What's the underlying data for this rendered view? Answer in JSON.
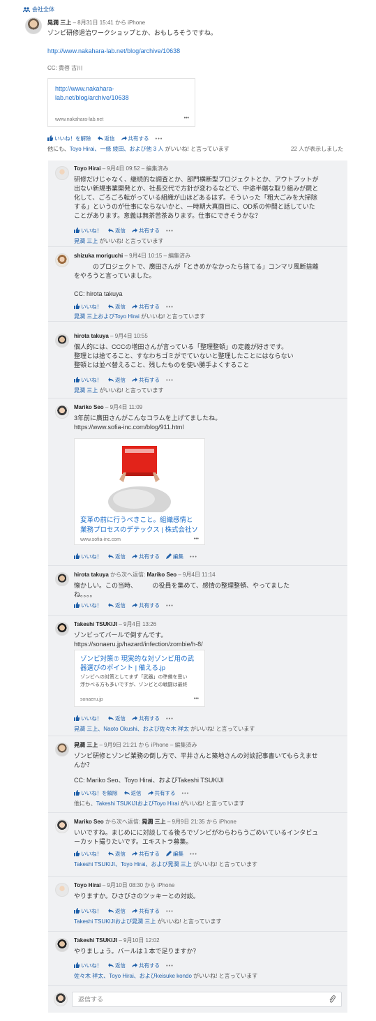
{
  "group": {
    "icon": "group-icon",
    "label": "会社全体"
  },
  "main": {
    "author": "晃潤 三上",
    "meta": " – 8月31日 15:41 から iPhone",
    "text": "ゾンビ研修退治ワークショップとか、おもしろそうですね。",
    "url": "http://www.nakahara-lab.net/blog/archive/10638",
    "cc": "CC: 貴啓 古川",
    "card": {
      "title_line1": "http://www.nakahara-",
      "title_line2": "lab.net/blog/archive/10638",
      "domain": "www.nakahara-lab.net",
      "more": "•••"
    },
    "actions": {
      "unlike": "いいね！を解除",
      "reply": "返信",
      "share": "共有する",
      "more": "•••"
    },
    "likes": {
      "prefix": "他にも、",
      "users": "Toyo Hirai、一條 綾田、および他 3 人",
      "suffix": " がいいね! と言っています"
    },
    "views": "22 人が表示しました"
  },
  "replies": [
    {
      "author": "Toyo Hirai",
      "meta": " – 9月4日 09:52 – 編集済み",
      "lines": [
        "研修だけじゃなく、継続的な調査とか、部門横断型プロジェクトとか、アウトプットが",
        "出ない新規事業開発とか、社長交代で方針が変わるなどで、中途半端な取り組みが屍と",
        "化して、ごろごろ転がっている組織が山ほどあるはず。そういった「粗大ごみを大掃除",
        "する」というのが仕事にならないかと、一時期大真面目に、OD系の仲間と話していた",
        "ことがあります。意義は無茶苦茶あります。仕事にできそうかな？"
      ],
      "actions": {
        "like": "いいね！",
        "reply": "返信",
        "share": "共有する",
        "more": "•••"
      },
      "likes": {
        "users": "晃潤 三上",
        "suffix": " がいいね! と言っています"
      }
    },
    {
      "author": "shizuka moriguchi",
      "meta": " – 9月4日 10:15 – 編集済み",
      "lines": [
        "　　　のプロジェクトで、廣田さんが「ときめかなかったら捨てる」コンマリ風断捨離",
        "をやろうと言っていました。"
      ],
      "cc": "CC: hirota takuya",
      "actions": {
        "like": "いいね！",
        "reply": "返信",
        "share": "共有する",
        "more": "•••"
      },
      "likes": {
        "users": "晃潤 三上およびToyo Hirai",
        "suffix": " がいいね! と言っています"
      }
    },
    {
      "author": "hirota takuya",
      "meta": " – 9月4日 10:55",
      "lines": [
        "個人的には、CCCの増田さんが言っている「整理整頓」の定義が好きです。",
        "整理とは捨てること、すなわちゴミがでていないと整理したことにはならない",
        "整頓とは並べ替えること、残したものを使い勝手よくすること"
      ],
      "actions": {
        "like": "いいね！",
        "reply": "返信",
        "share": "共有する",
        "more": "•••"
      },
      "likes": {
        "users": "晃潤 三上",
        "suffix": " がいいね! と言っています"
      }
    },
    {
      "author": "Mariko Seo",
      "meta": " – 9月4日 11:09",
      "lines": [
        "3年前に廣田さんがこんなコラムを上げてましたね。"
      ],
      "url": "https://www.sofia-inc.com/blog/911.html",
      "card": {
        "title_line1": "変革の前に行うべきこと。組織感情と",
        "title_line2": "業務プロセスのデテックス | 株式会社ソ",
        "domain": "www.sofia-inc.com",
        "more": "•••"
      },
      "actions": {
        "like": "いいね！",
        "reply": "返信",
        "share": "共有する",
        "edit": "編集",
        "more": "•••"
      }
    },
    {
      "author": "hirota takuya",
      "meta_mid": " から次へ返信: ",
      "reply_to": "Mariko Seo",
      "meta": " – 9月4日 11:14",
      "lines": [
        "懐かしい。この当時、　　　の役員を集めて、感情の整理整頓、やってました",
        "ね。。。。"
      ],
      "actions": {
        "like": "いいね！",
        "reply": "返信",
        "share": "共有する",
        "more": "•••"
      }
    },
    {
      "author": "Takeshi TSUKIJI",
      "meta": " – 9月4日 13:26",
      "lines": [
        "ゾンビってバールで倒すんです。"
      ],
      "url": " https://sonaeru.jp/hazard/infection/zombie/h-8/",
      "card": {
        "title_line1": "ゾンビ対策⑦ 現実的な対ゾンビ用の武",
        "title_line2": "器選びのポイント | 備える.jp",
        "desc1": "ゾンビへの対策としてまず「武器」の準備を思い",
        "desc2": "浮かべる方も多いですが、ゾンビとの戦闘は最終",
        "domain": "sonaeru.jp",
        "more": "•••"
      },
      "actions": {
        "like": "いいね！",
        "reply": "返信",
        "share": "共有する",
        "more": "•••"
      },
      "likes": {
        "users": "晃潤 三上、Naoto Okushi、および佐々木 祥太",
        "suffix": " がいいね! と言っています"
      }
    },
    {
      "author": "晃潤 三上",
      "meta": " – 9月9日 21:21 から iPhone – 編集済み",
      "lines": [
        "ゾンビ研修とゾンビ業務の倒し方で、平井さんと築地さんの対談記事書いてもらえませ",
        "んか？"
      ],
      "cc": "CC: Mariko Seo、Toyo Hirai、およびTakeshi TSUKIJI",
      "actions": {
        "like": "いいね！を解除",
        "reply": "返信",
        "share": "共有する",
        "more": "•••"
      },
      "likes": {
        "prefix": "他にも、",
        "users": "Takeshi TSUKIJIおよびToyo Hirai",
        "suffix": " がいいね! と言っています"
      }
    },
    {
      "author": "Mariko Seo",
      "meta_mid": " から次へ返信: ",
      "reply_to": "晃潤 三上",
      "meta": " – 9月9日 21:35 から iPhone",
      "lines": [
        "いいですね。まじめにに対談してる後ろでゾンビがわらわらうごめいているインタビュ",
        "ーカット撮りたいです。エキストラ募集。"
      ],
      "actions": {
        "like": "いいね！",
        "reply": "返信",
        "share": "共有する",
        "edit": "編集",
        "more": "•••"
      },
      "likes": {
        "users": "Takeshi TSUKIJI、Toyo Hirai、および晃潤 三上",
        "suffix": " がいいね! と言っています"
      }
    },
    {
      "author": "Toyo Hirai",
      "meta": " – 9月10日 08:30 から iPhone",
      "lines": [
        "やりますか。ひさびさのツッキーとの対談。"
      ],
      "actions": {
        "like": "いいね！",
        "reply": "返信",
        "share": "共有する",
        "more": "•••"
      },
      "likes": {
        "users": "Takeshi TSUKIJIおよび晃潤 三上",
        "suffix": " がいいね! と言っています"
      }
    },
    {
      "author": "Takeshi TSUKIJI",
      "meta": " – 9月10日 12:02",
      "lines": [
        "やりましょう。バールは１本で足りますか？"
      ],
      "actions": {
        "like": "いいね！",
        "reply": "返信",
        "share": "共有する",
        "more": "•••"
      },
      "likes": {
        "users": "佐々木 祥太、Toyo Hirai、およびkeisuke kondo",
        "suffix": " がいいね! と言っています"
      }
    }
  ],
  "reply_box": {
    "placeholder": "返信する",
    "icon": "paperclip-icon"
  },
  "colors": {
    "link": "#1f6fc8",
    "thread_bg": "#f0f1f3",
    "card_link": "#1f6fc8"
  }
}
